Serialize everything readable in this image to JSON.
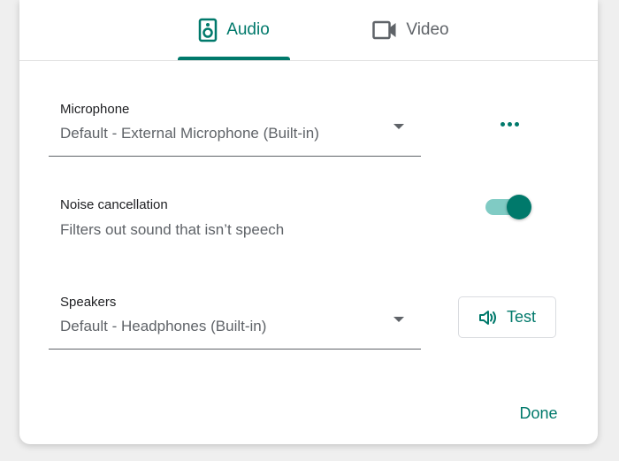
{
  "tabs": {
    "audio": {
      "label": "Audio",
      "icon": "speaker-icon",
      "selected": true
    },
    "video": {
      "label": "Video",
      "icon": "videocam-icon",
      "selected": false
    }
  },
  "microphone": {
    "label": "Microphone",
    "value": "Default - External Microphone (Built-in)",
    "more_icon": "more-horiz-icon"
  },
  "noise_cancellation": {
    "title": "Noise cancellation",
    "description": "Filters out sound that isn’t speech",
    "enabled": true
  },
  "speakers": {
    "label": "Speakers",
    "value": "Default - Headphones (Built-in)",
    "test_label": "Test",
    "test_icon": "volume-icon"
  },
  "footer": {
    "done_label": "Done"
  },
  "colors": {
    "accent": "#00796b",
    "accent_light": "#80cbc4",
    "text_secondary": "#5f6368",
    "text_primary": "#202124"
  }
}
